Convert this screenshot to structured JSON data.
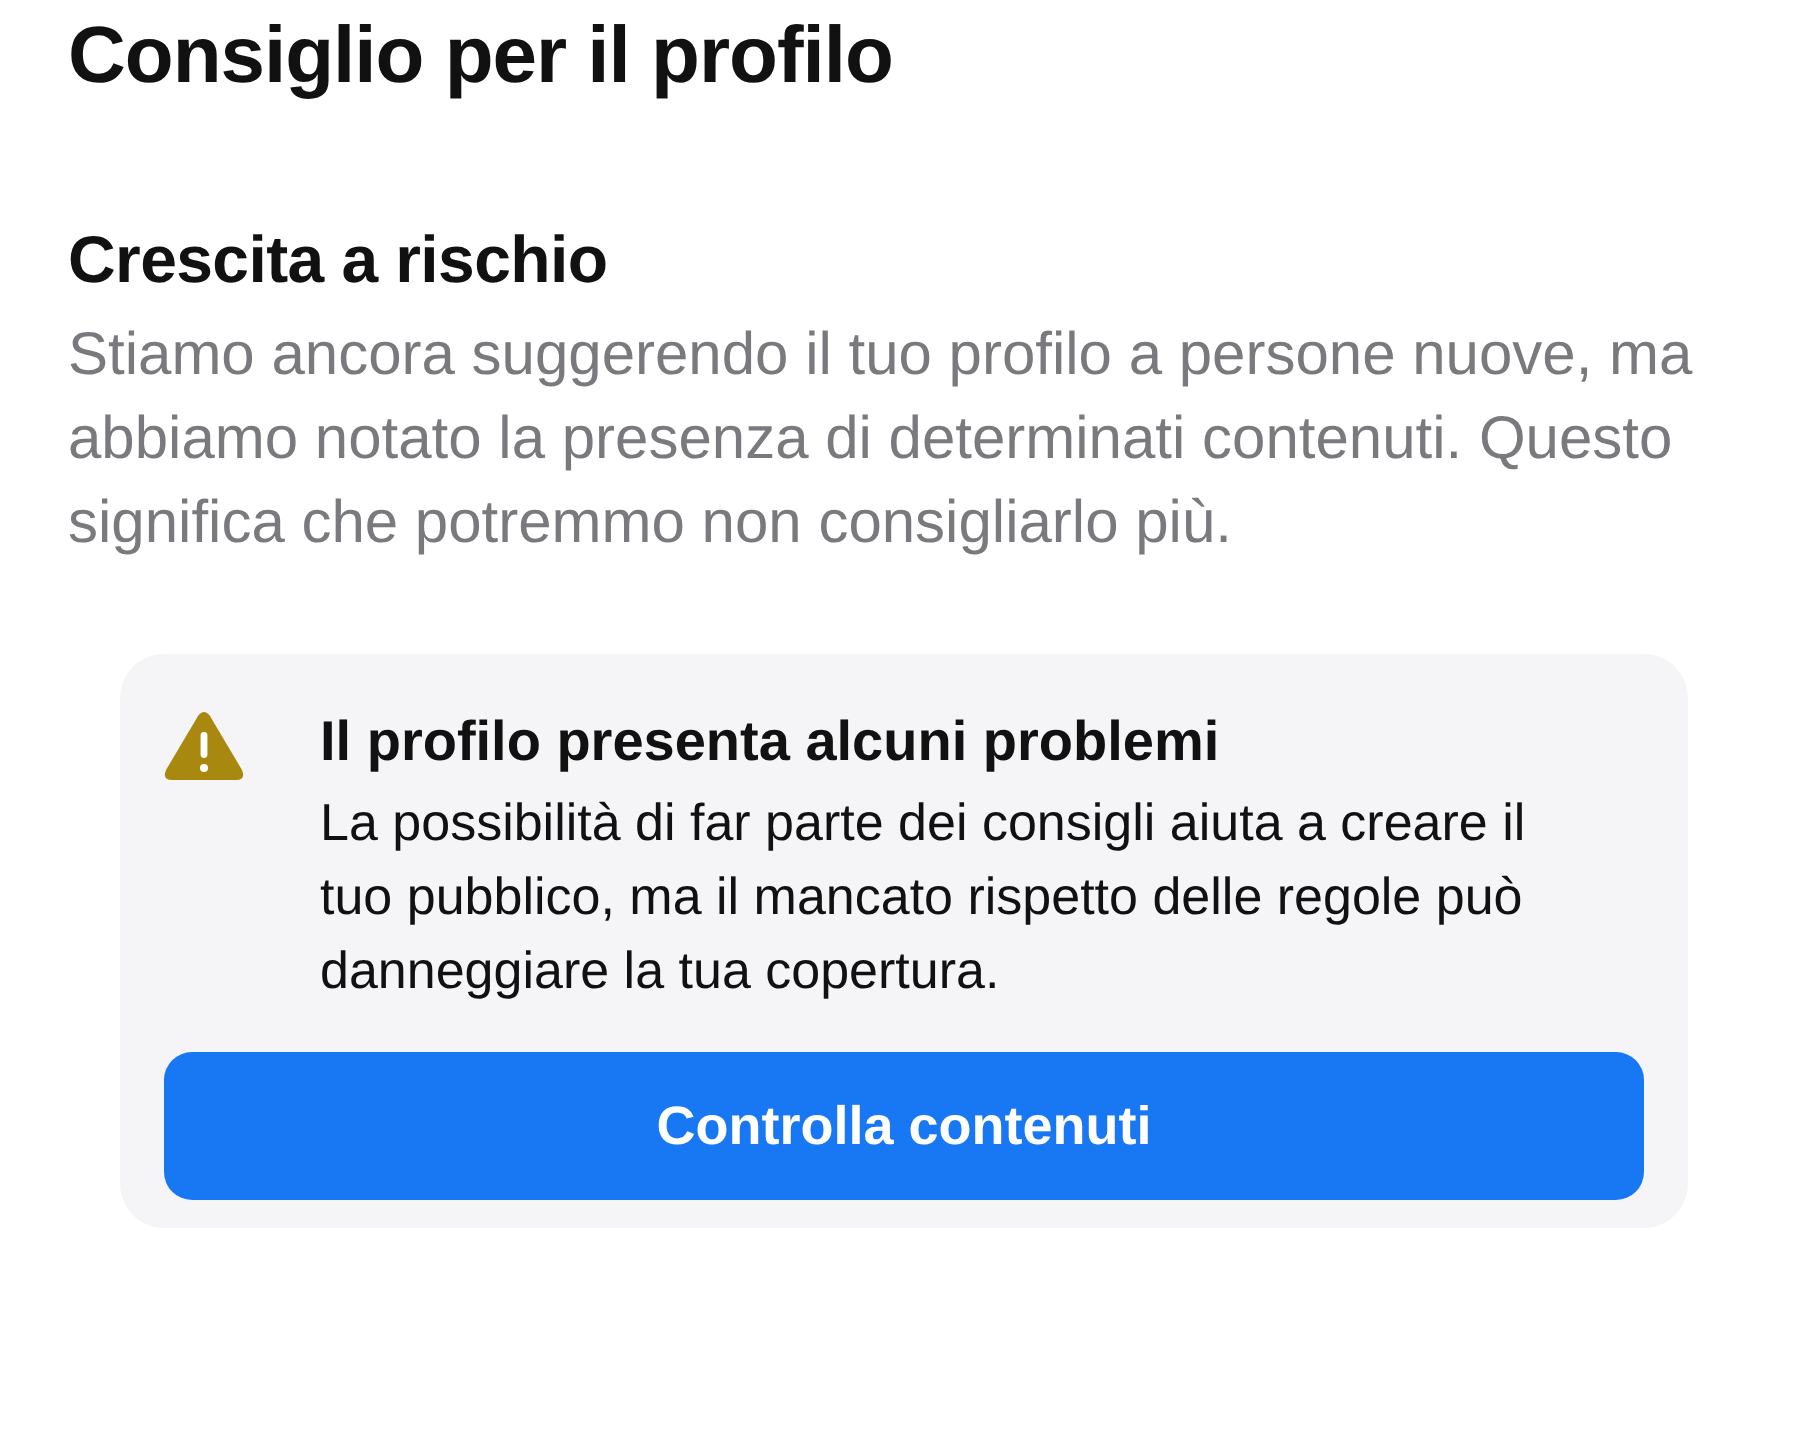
{
  "title": "Consiglio per il profilo",
  "status": {
    "heading": "Crescita a rischio",
    "description": "Stiamo ancora suggerendo il tuo profilo a persone nuove, ma abbiamo notato la presenza di determinati contenuti. Questo significa che potremmo non consigliarlo più."
  },
  "alert": {
    "title": "Il profilo presenta alcuni problemi",
    "body": "La possibilità di far parte dei consigli aiuta a creare il tuo pubblico, ma il mancato rispetto delle regole può danneggiare la tua copertura.",
    "button": "Controlla contenuti"
  }
}
